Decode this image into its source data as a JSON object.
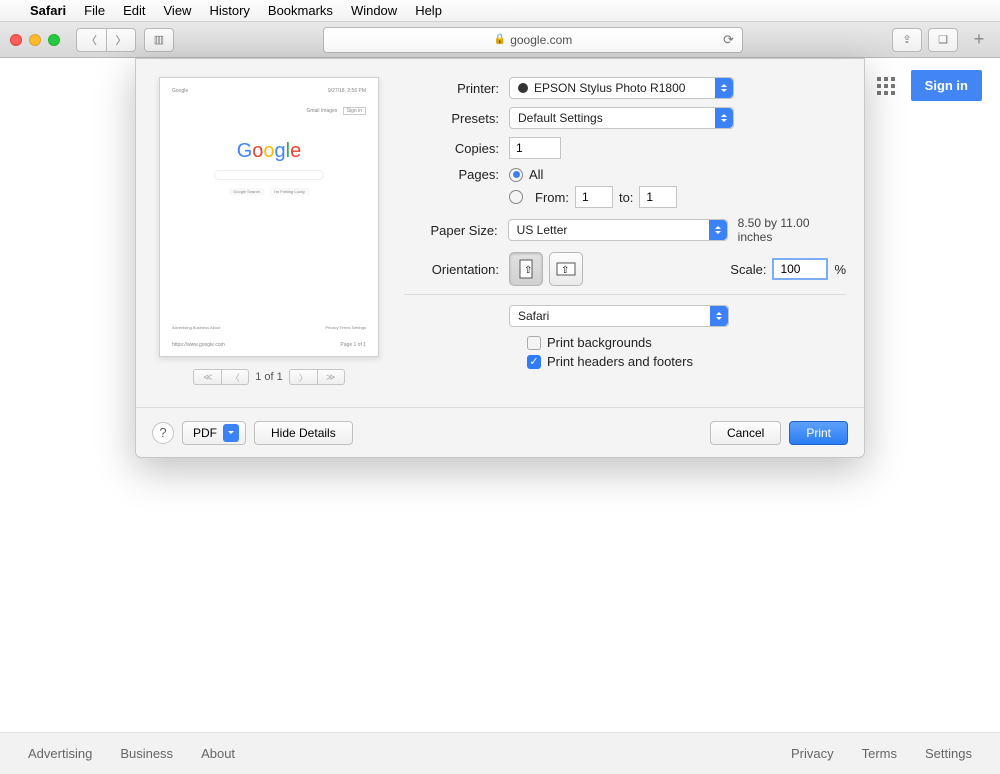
{
  "menubar": {
    "appname": "Safari",
    "items": [
      "File",
      "Edit",
      "View",
      "History",
      "Bookmarks",
      "Window",
      "Help"
    ]
  },
  "safari": {
    "url_host": "google.com",
    "signin": "Sign in"
  },
  "footer": {
    "left": [
      "Advertising",
      "Business",
      "About"
    ],
    "right": [
      "Privacy",
      "Terms",
      "Settings"
    ]
  },
  "print": {
    "labels": {
      "printer": "Printer:",
      "presets": "Presets:",
      "copies": "Copies:",
      "pages": "Pages:",
      "all": "All",
      "from": "From:",
      "to": "to:",
      "paper_size": "Paper Size:",
      "orientation": "Orientation:",
      "scale": "Scale:",
      "percent": "%",
      "print_backgrounds": "Print backgrounds",
      "print_headers_footers": "Print headers and footers",
      "hide_details": "Hide Details",
      "pdf": "PDF",
      "cancel": "Cancel",
      "print_btn": "Print",
      "page_of": "1 of 1"
    },
    "values": {
      "printer": "EPSON Stylus Photo R1800",
      "presets": "Default Settings",
      "copies": "1",
      "pages_mode": "all",
      "from": "1",
      "to": "1",
      "paper_size": "US Letter",
      "paper_dims": "8.50 by 11.00 inches",
      "scale": "100",
      "app_menu": "Safari",
      "print_backgrounds": false,
      "print_headers_footers": true
    },
    "preview": {
      "header_left": "Google",
      "header_right_top": "9/27/18, 2:56 PM",
      "mid_right": "Gmail   Images",
      "search_btn": "Google Search",
      "lucky_btn": "I'm Feeling Lucky",
      "foot_left": "Advertising   Business   About",
      "foot_right": "Privacy   Terms   Settings",
      "url": "https://www.google.com",
      "page_counter": "Page 1 of 1"
    }
  }
}
